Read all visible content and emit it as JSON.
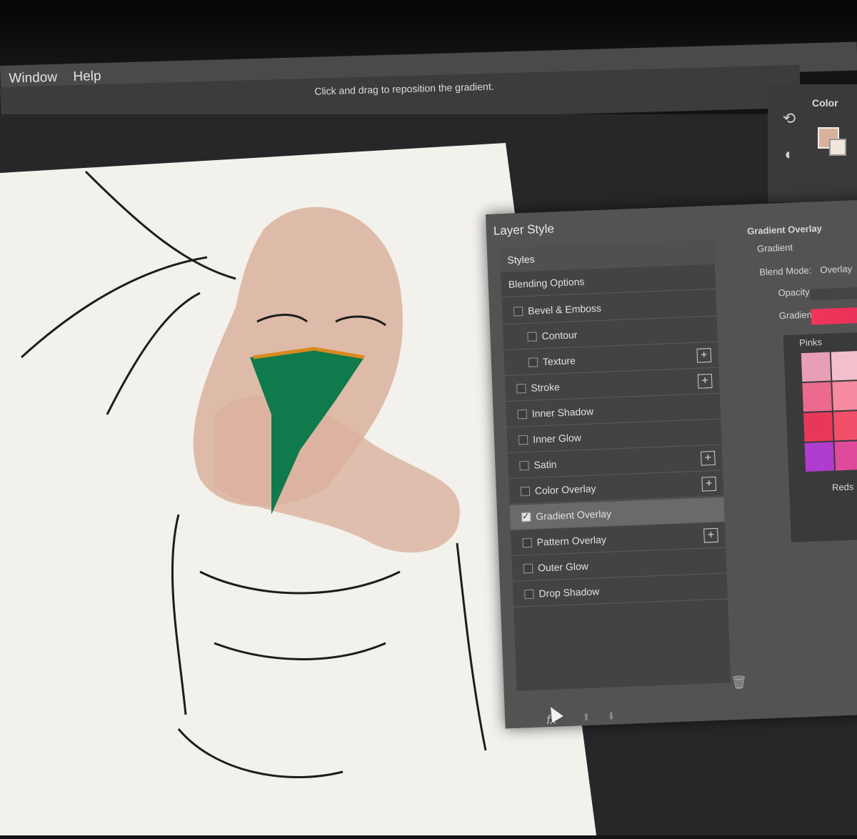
{
  "menubar": {
    "items": [
      "Window",
      "Help"
    ]
  },
  "options_bar": {
    "hint": "Click and drag to reposition the gradient."
  },
  "right_panel": {
    "color_tab": "Color",
    "fg_color": "#d9b29d",
    "bg_color": "#f2e6dc"
  },
  "layer_style": {
    "title": "Layer Style",
    "styles_header": "Styles",
    "blending_options": "Blending Options",
    "effects": [
      {
        "label": "Bevel & Emboss",
        "checked": false,
        "indent": false,
        "plus": false
      },
      {
        "label": "Contour",
        "checked": false,
        "indent": true,
        "plus": false
      },
      {
        "label": "Texture",
        "checked": false,
        "indent": true,
        "plus": true
      },
      {
        "label": "Stroke",
        "checked": false,
        "indent": false,
        "plus": true
      },
      {
        "label": "Inner Shadow",
        "checked": false,
        "indent": false,
        "plus": false
      },
      {
        "label": "Inner Glow",
        "checked": false,
        "indent": false,
        "plus": false
      },
      {
        "label": "Satin",
        "checked": false,
        "indent": false,
        "plus": true
      },
      {
        "label": "Color Overlay",
        "checked": false,
        "indent": false,
        "plus": true
      },
      {
        "label": "Gradient Overlay",
        "checked": true,
        "indent": false,
        "plus": false,
        "selected": true
      },
      {
        "label": "Pattern Overlay",
        "checked": false,
        "indent": false,
        "plus": true
      },
      {
        "label": "Outer Glow",
        "checked": false,
        "indent": false,
        "plus": false
      },
      {
        "label": "Drop Shadow",
        "checked": false,
        "indent": false,
        "plus": false
      }
    ],
    "fx_label": "fx",
    "gradient_overlay": {
      "section_title": "Gradient Overlay",
      "sub_title": "Gradient",
      "blend_mode_label": "Blend Mode:",
      "blend_mode_value": "Overlay",
      "opacity_label": "Opacity:",
      "gradient_label": "Gradient:",
      "gradient_color": "#ee3458"
    },
    "gradient_presets": {
      "group1": "Pinks",
      "group2": "Reds",
      "swatches": [
        "#e89fb6",
        "#f2c0cc",
        "#f7d3dc",
        "#ec6a8d",
        "#f58aa0",
        "#f9b7c3",
        "#e8385a",
        "#f24f6a",
        "#f77a8a",
        "#b03ccf",
        "#e04a9a",
        "#f06a7a"
      ]
    }
  }
}
